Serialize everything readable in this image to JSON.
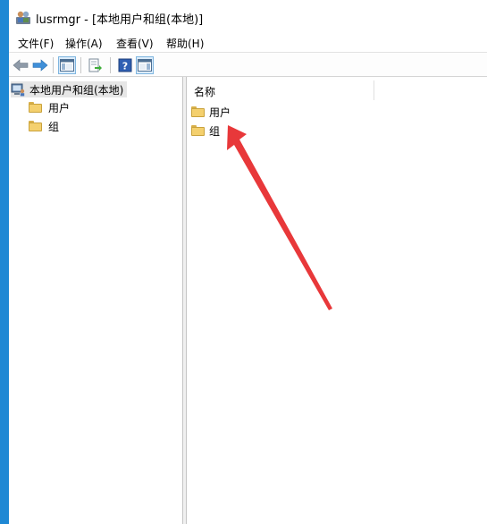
{
  "window": {
    "title": "lusrmgr - [本地用户和组(本地)]"
  },
  "menu": {
    "items": [
      "文件(F)",
      "操作(A)",
      "查看(V)",
      "帮助(H)"
    ]
  },
  "toolbar": {
    "buttons": [
      "back-icon",
      "forward-icon",
      "show-hide-console-tree-icon",
      "export-list-icon",
      "help-icon",
      "show-hide-action-pane-icon"
    ]
  },
  "tree": {
    "root_label": "本地用户和组(本地)",
    "children": [
      "用户",
      "组"
    ]
  },
  "list": {
    "column_header": "名称",
    "rows": [
      "用户",
      "组"
    ]
  },
  "colors": {
    "accent": "#1e88d4",
    "annotation_arrow": "#e8383a",
    "folder": "#f4d06e"
  }
}
